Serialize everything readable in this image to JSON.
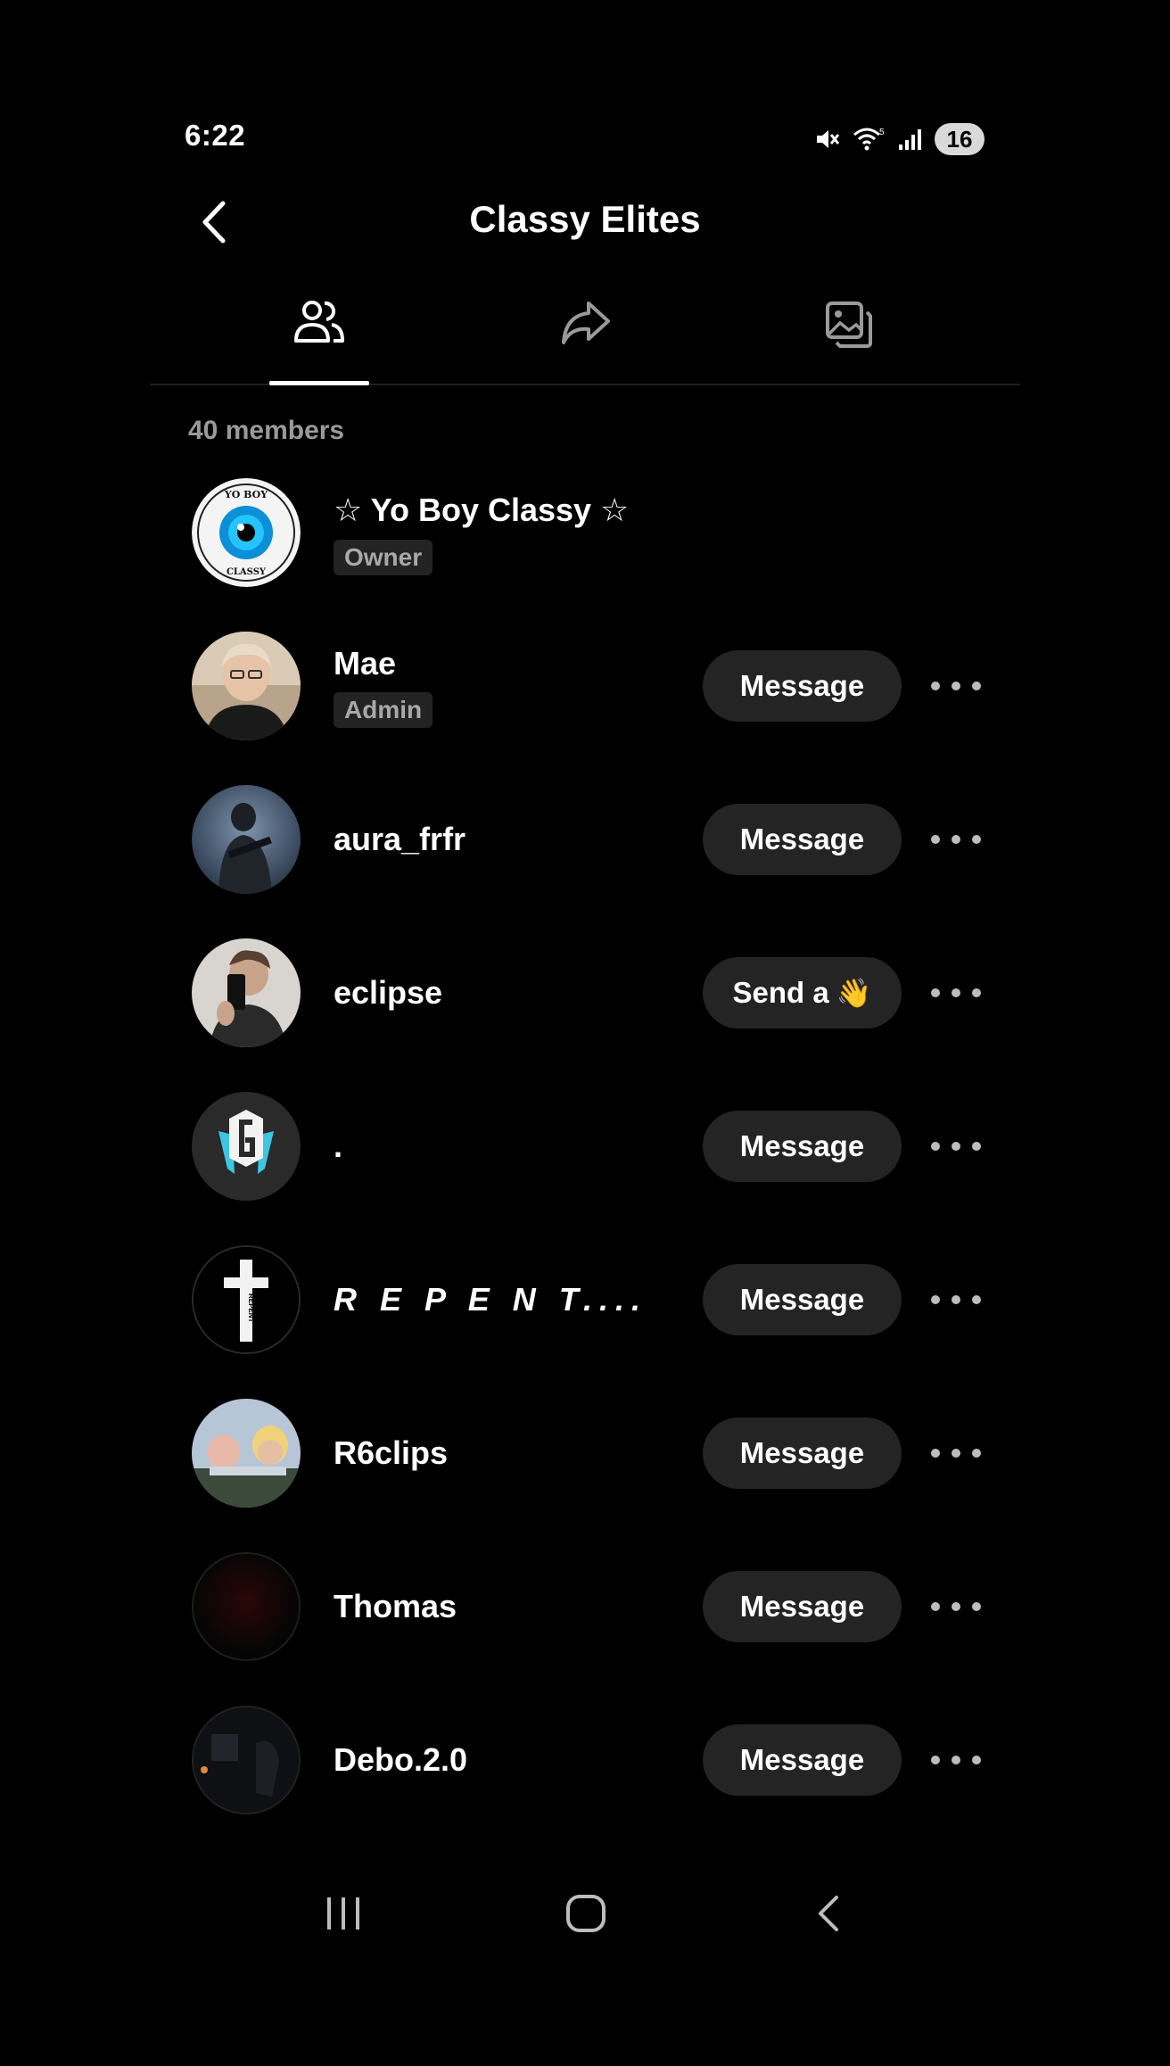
{
  "status_bar": {
    "time": "6:22",
    "battery": "16",
    "icons": [
      "mute-icon",
      "wifi-icon",
      "signal-icon",
      "battery-icon"
    ]
  },
  "header": {
    "title": "Classy Elites",
    "back_icon": "chevron-left-icon"
  },
  "tabs": [
    {
      "name": "members",
      "icon": "people-icon",
      "selected": true
    },
    {
      "name": "share",
      "icon": "share-icon",
      "selected": false
    },
    {
      "name": "media",
      "icon": "gallery-icon",
      "selected": false
    }
  ],
  "member_count": "40 members",
  "members": [
    {
      "name": "☆ Yo Boy Classy ☆",
      "role": "Owner",
      "action": "",
      "avatar_text": [
        "YO BOY",
        "CLASSY"
      ]
    },
    {
      "name": "Mae",
      "role": "Admin",
      "action": "Message"
    },
    {
      "name": "aura_frfr",
      "role": "",
      "action": "Message"
    },
    {
      "name": "eclipse",
      "role": "",
      "action": "Send a",
      "action_icon": "👋"
    },
    {
      "name": ".",
      "role": "",
      "action": "Message"
    },
    {
      "name": "R E P E N T....",
      "role": "",
      "action": "Message",
      "avatar_text": "REPENT"
    },
    {
      "name": "R6clips",
      "role": "",
      "action": "Message"
    },
    {
      "name": "Thomas",
      "role": "",
      "action": "Message"
    },
    {
      "name": "Debo.2.0",
      "role": "",
      "action": "Message"
    }
  ],
  "colors": {
    "background": "#000000",
    "button_bg": "#242424",
    "muted_text": "#9a9a9a",
    "role_badge_bg": "#232323"
  }
}
